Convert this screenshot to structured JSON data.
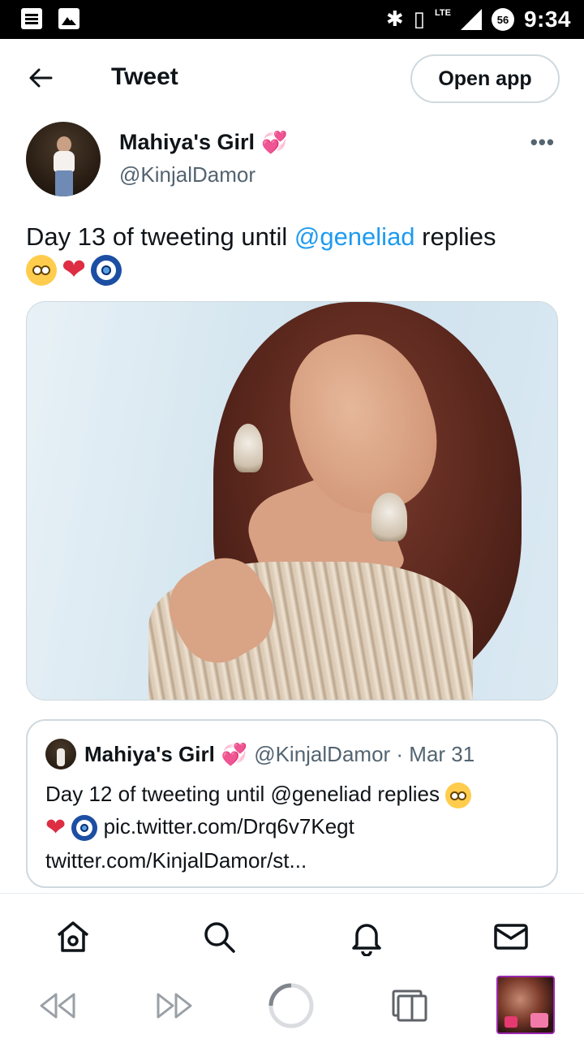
{
  "status_bar": {
    "time": "9:34",
    "lte_label": "LTE",
    "battery_badge": "56",
    "icons": [
      "document-icon",
      "image-icon",
      "bluetooth-icon",
      "vibrate-icon",
      "signal-icon"
    ]
  },
  "header": {
    "title": "Tweet",
    "open_app_label": "Open app",
    "back_icon": "arrow-left-icon"
  },
  "tweet": {
    "author_name": "Mahiya's Girl",
    "author_badge_emoji": "💞",
    "author_handle": "@KinjalDamor",
    "more_label": "•••",
    "text_before": "Day 13 of tweeting until ",
    "mention": "@geneliad",
    "text_after": " replies",
    "heart_emoji": "❤",
    "media_icon": "photo"
  },
  "quote": {
    "author_name": "Mahiya's Girl",
    "author_badge_emoji": "💞",
    "handle_date": "@KinjalDamor · Mar 31",
    "line1": "Day 12 of tweeting until @geneliad replies ",
    "heart_emoji": "❤",
    "pic_link": " pic.twitter.com/Drq6v7Kegt",
    "url_line": "twitter.com/KinjalDamor/st..."
  },
  "twitter_nav": {
    "items": [
      "home-icon",
      "search-icon",
      "notifications-icon",
      "messages-icon"
    ]
  },
  "browser_bar": {
    "items": [
      "back-icon",
      "forward-icon",
      "reload-icon",
      "tabs-icon",
      "profile-avatar"
    ]
  },
  "colors": {
    "accent": "#1d9bf0",
    "text_primary": "#0f1419",
    "text_secondary": "#536471",
    "border": "#cfd9de",
    "heart": "#dd2e44"
  }
}
